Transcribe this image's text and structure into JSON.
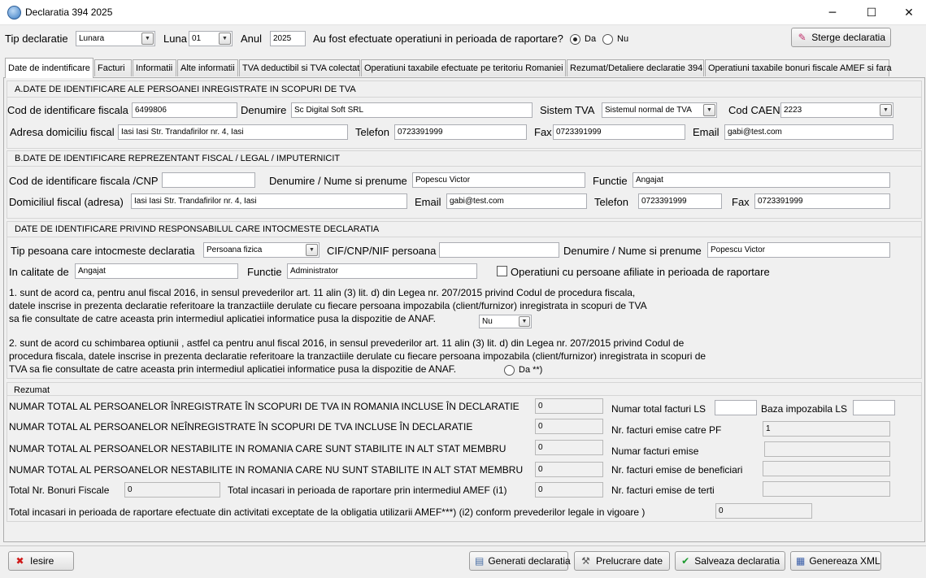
{
  "window": {
    "title": "Declaratia 394  2025",
    "minimize": "─",
    "maximize": "☐",
    "close": "✕"
  },
  "header": {
    "tip_label": "Tip declaratie",
    "tip_value": "Lunara",
    "luna_label": "Luna",
    "luna_value": "01",
    "anul_label": "Anul",
    "anul_value": "2025",
    "question": "Au fost efectuate operatiuni in perioada de raportare?",
    "da": "Da",
    "nu": "Nu",
    "sterge": "Sterge declaratia"
  },
  "tabs": [
    "Date de indentificare",
    "Facturi",
    "Informatii",
    "Alte informatii",
    "TVA deductibil si TVA colectat",
    "Operatiuni taxabile efectuate pe teritoriu Romaniei",
    "Rezumat/Detaliere declaratie 394",
    "Operatiuni taxabile bonuri fiscale AMEF si fara"
  ],
  "sectionA": {
    "title": "A.DATE DE IDENTIFICARE ALE PERSOANEI INREGISTRATE IN SCOPURI DE TVA",
    "cif_label": "Cod de identificare fiscala",
    "cif_value": "6499806",
    "den_label": "Denumire",
    "den_value": "Sc Digital Soft SRL",
    "sistem_label": "Sistem TVA",
    "sistem_value": "Sistemul normal de TVA",
    "caen_label": "Cod CAEN",
    "caen_value": "2223",
    "adr_label": "Adresa domiciliu fiscal",
    "adr_value": "Iasi Iasi Str. Trandafirilor nr. 4, Iasi",
    "tel_label": "Telefon",
    "tel_value": "0723391999",
    "fax_label": "Fax",
    "fax_value": "0723391999",
    "email_label": "Email",
    "email_value": "gabi@test.com"
  },
  "sectionB": {
    "title": "B.DATE DE IDENTIFICARE REPREZENTANT FISCAL / LEGAL / IMPUTERNICIT",
    "cif_label": "Cod de identificare fiscala /CNP",
    "cif_value": "",
    "den_label": "Denumire / Nume si prenume",
    "den_value": "Popescu Victor",
    "func_label": "Functie",
    "func_value": "Angajat",
    "dom_label": "Domiciliul fiscal (adresa)",
    "dom_value": "Iasi Iasi Str. Trandafirilor nr. 4, Iasi",
    "email_label": "Email",
    "email_value": "gabi@test.com",
    "tel_label": "Telefon",
    "tel_value": "0723391999",
    "fax_label": "Fax",
    "fax_value": "0723391999"
  },
  "sectionC": {
    "title": "DATE DE IDENTIFICARE PRIVIND RESPONSABILUL CARE INTOCMESTE DECLARATIA",
    "tip_label": "Tip pesoana care intocmeste declaratia",
    "tip_value": "Persoana fizica",
    "cif_label": "CIF/CNP/NIF persoana",
    "cif_value": "",
    "den_label": "Denumire / Nume si prenume",
    "den_value": "Popescu Victor",
    "calitate_label": "In calitate de",
    "calitate_value": "Angajat",
    "func_label": "Functie",
    "func_value": "Administrator",
    "afiliate_label": "Operatiuni cu persoane afiliate in perioada de raportare",
    "p1_line1": "1. sunt de acord ca, pentru anul fiscal 2016, in sensul prevederilor art. 11 alin (3) lit. d) din Legea nr. 207/2015 privind  Codul de procedura fiscala,",
    "p1_line2": "datele inscrise in prezenta declaratie referitoare la tranzactiile derulate cu fiecare persoana impozabila (client/furnizor) inregistrata in scopuri de TVA",
    "p1_line3": "sa fie consultate de catre aceasta prin intermediul aplicatiei informatice pusa la dispozitie de ANAF.",
    "p1_value": "Nu",
    "p2_line1": "2. sunt de acord cu schimbarea optiunii , astfel ca pentru anul fiscal 2016, in sensul prevederilor art. 11 alin (3) lit. d) din Legea nr. 207/2015 privind Codul de",
    "p2_line2": "procedura fiscala, datele inscrise in prezenta declaratie referitoare la tranzactiile derulate cu fiecare persoana impozabila (client/furnizor) inregistrata in scopuri de",
    "p2_line3": "TVA sa fie consultate de catre aceasta prin intermediul aplicatiei informatice pusa la dispozitie de ANAF.",
    "p2_radio": "Da **)"
  },
  "rezumat": {
    "title": "Rezumat",
    "r1_label": "NUMAR TOTAL AL PERSOANELOR ÎNREGISTRATE ÎN SCOPURI DE TVA IN ROMANIA INCLUSE ÎN DECLARATIE",
    "r1_value": "0",
    "r2_label": "NUMAR TOTAL AL PERSOANELOR NEÎNREGISTRATE ÎN SCOPURI DE TVA INCLUSE ÎN DECLARATIE",
    "r2_value": "0",
    "r3_label": "NUMAR TOTAL AL PERSOANELOR NESTABILITE IN ROMANIA CARE SUNT STABILITE IN ALT STAT MEMBRU",
    "r3_value": "0",
    "r4_label": "NUMAR TOTAL AL PERSOANELOR NESTABILITE IN ROMANIA CARE NU SUNT STABILITE IN ALT STAT MEMBRU",
    "r4_value": "0",
    "bonuri_label": "Total Nr. Bonuri Fiscale",
    "bonuri_value": "0",
    "amef_label": "Total incasari in perioada de raportare prin intermediul AMEF (i1)",
    "amef_value": "0",
    "excep_label": "Total incasari in perioada de raportare efectuate din activitati exceptate de la obligatia utilizarii AMEF***) (i2) conform prevederilor legale in vigoare )",
    "excep_value": "0",
    "ls_label": "Numar total facturi LS",
    "ls_value": "",
    "baza_label": "Baza impozabila LS",
    "baza_value": "",
    "pf_label": "Nr. facturi  emise catre PF",
    "pf_value": "1",
    "emise_label": "Numar facturi  emise",
    "emise_value": "",
    "benef_label": "Nr. facturi  emise de beneficiari",
    "benef_value": "",
    "terti_label": "Nr. facturi  emise de terti",
    "terti_value": ""
  },
  "footer": {
    "iesire": "Iesire",
    "generati": "Generati declaratia",
    "prelucrare": "Prelucrare date",
    "salveaza": "Salveaza declaratia",
    "genereaza": "Genereaza XML"
  }
}
